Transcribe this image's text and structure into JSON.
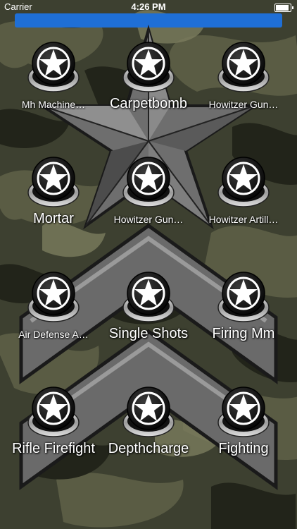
{
  "status_bar": {
    "carrier": "Carrier",
    "time": "4:26 PM"
  },
  "colors": {
    "top_bar": "#1f6fd6",
    "label_text": "#ffffff"
  },
  "buttons": [
    {
      "label": "Mh Machine…",
      "icon": "star-icon"
    },
    {
      "label": "Carpetbomb",
      "icon": "star-icon"
    },
    {
      "label": "Howitzer Gun…",
      "icon": "star-icon"
    },
    {
      "label": "Mortar",
      "icon": "star-icon"
    },
    {
      "label": "Howitzer Gun…",
      "icon": "star-icon"
    },
    {
      "label": "Howitzer Artill…",
      "icon": "star-icon"
    },
    {
      "label": "Air Defense A…",
      "icon": "star-icon"
    },
    {
      "label": "Single Shots",
      "icon": "star-icon"
    },
    {
      "label": "Firing Mm",
      "icon": "star-icon"
    },
    {
      "label": "Rifle Firefight",
      "icon": "star-icon"
    },
    {
      "label": "Depthcharge",
      "icon": "star-icon"
    },
    {
      "label": "Fighting",
      "icon": "star-icon"
    }
  ]
}
